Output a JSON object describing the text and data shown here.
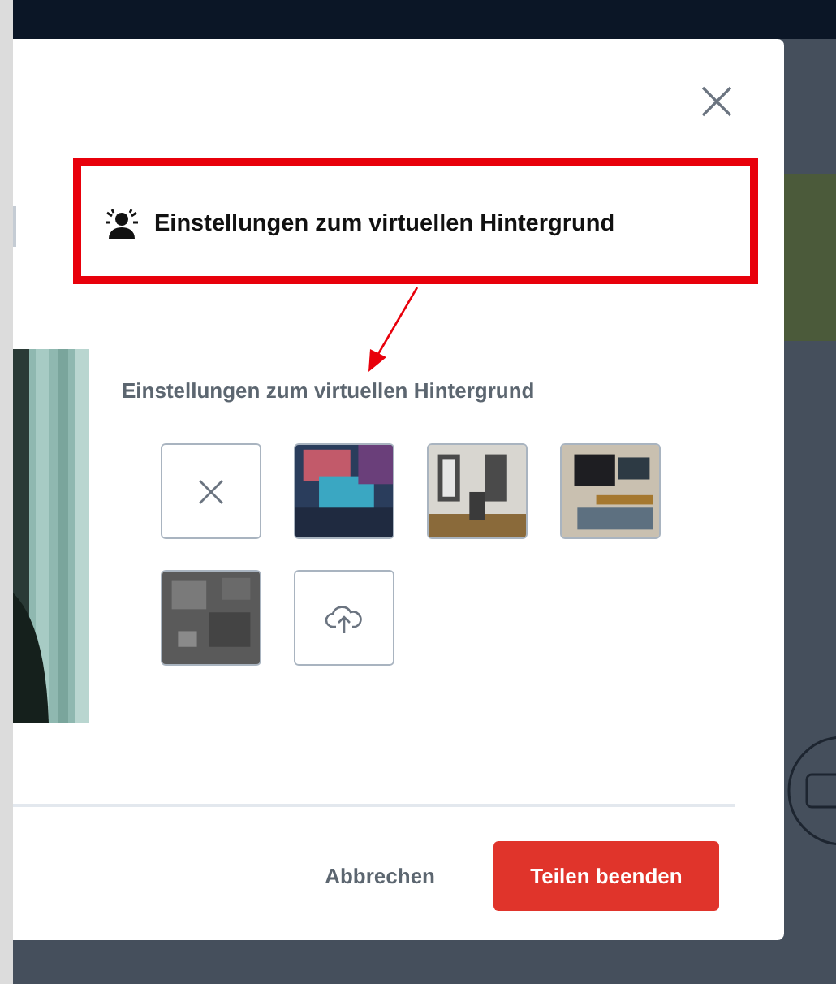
{
  "dialog": {
    "title": "Einstellungen zum virtuellen Hintergrund",
    "section_label": "Einstellungen zum virtuellen Hintergrund",
    "tiles": [
      {
        "kind": "none",
        "selected": false
      },
      {
        "kind": "picture",
        "selected": false
      },
      {
        "kind": "picture",
        "selected": false
      },
      {
        "kind": "picture",
        "selected": false
      },
      {
        "kind": "picture",
        "selected": false
      },
      {
        "kind": "upload",
        "selected": false
      }
    ],
    "buttons": [
      {
        "label": "Abbrechen",
        "kind": "secondary"
      },
      {
        "label": "Teilen beenden",
        "kind": "primary"
      }
    ]
  }
}
